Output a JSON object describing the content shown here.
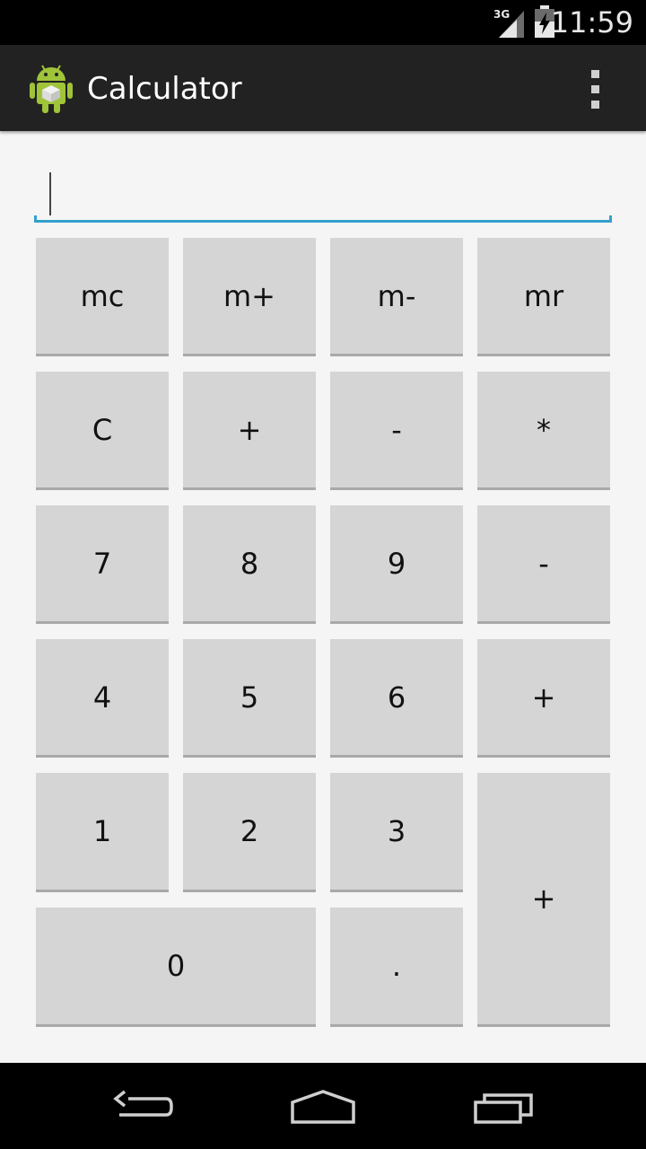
{
  "status_bar": {
    "network": "3G",
    "time": "11:59"
  },
  "action_bar": {
    "title": "Calculator",
    "icon": "android-app-icon",
    "overflow_icon": "overflow-menu-icon"
  },
  "display": {
    "value": ""
  },
  "keys": {
    "mc": "mc",
    "m_plus": "m+",
    "m_minus": "m-",
    "mr": "mr",
    "clear": "C",
    "plus_top": "+",
    "minus_top": "-",
    "multiply": "*",
    "seven": "7",
    "eight": "8",
    "nine": "9",
    "minus": "-",
    "four": "4",
    "five": "5",
    "six": "6",
    "plus": "+",
    "one": "1",
    "two": "2",
    "three": "3",
    "plus_tall": "+",
    "zero": "0",
    "dot": "."
  },
  "nav_bar": {
    "back_icon": "back-icon",
    "home_icon": "home-icon",
    "recents_icon": "recents-icon"
  },
  "colors": {
    "accent": "#33a0cc",
    "action_bar": "#222222",
    "key": "#d5d5d5",
    "background": "#f5f5f5"
  }
}
